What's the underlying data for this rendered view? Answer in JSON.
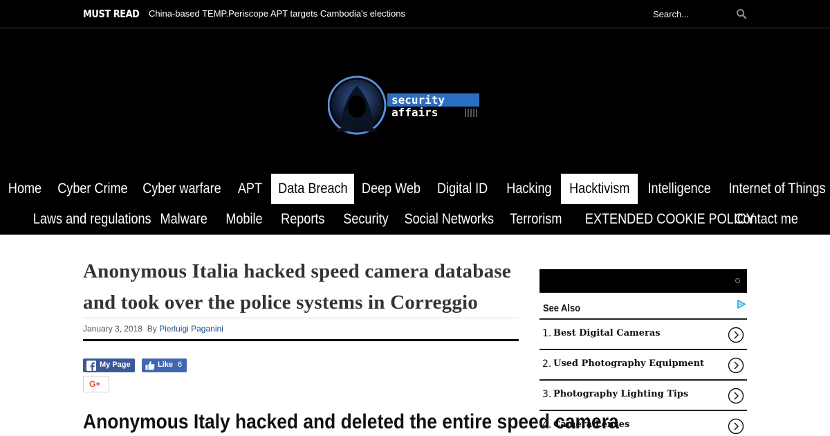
{
  "topbar": {
    "must_read_label": "MUST READ",
    "headline": "China-based TEMP.Periscope APT targets Cambodia's elections",
    "search_placeholder": "Search...",
    "search_icon": "search-icon"
  },
  "logo": {
    "line1": "security",
    "line2": "affairs"
  },
  "nav": {
    "items": [
      {
        "label": "Home",
        "active": false
      },
      {
        "label": "Cyber Crime",
        "active": false
      },
      {
        "label": "Cyber warfare",
        "active": false
      },
      {
        "label": "APT",
        "active": false
      },
      {
        "label": "Data Breach",
        "active": true
      },
      {
        "label": "Deep Web",
        "active": false
      },
      {
        "label": "Digital ID",
        "active": false
      },
      {
        "label": "Hacking",
        "active": false
      },
      {
        "label": "Hacktivism",
        "active": true
      },
      {
        "label": "Intelligence",
        "active": false
      },
      {
        "label": "Internet of Things",
        "active": false
      },
      {
        "label": "Laws and regulations",
        "active": false
      },
      {
        "label": "Malware",
        "active": false
      },
      {
        "label": "Mobile",
        "active": false
      },
      {
        "label": "Reports",
        "active": false
      },
      {
        "label": "Security",
        "active": false
      },
      {
        "label": "Social Networks",
        "active": false
      },
      {
        "label": "Terrorism",
        "active": false
      },
      {
        "label": "EXTENDED COOKIE POLICY",
        "active": false
      },
      {
        "label": "Contact me",
        "active": false
      }
    ]
  },
  "article": {
    "title": "Anonymous Italia hacked speed camera database and took over the police systems in Correggio",
    "date": "January 3, 2018",
    "by_label": "By",
    "author": "Pierluigi Paganini",
    "share": {
      "facebook_label": "My Page",
      "like_label": "Like",
      "like_count": "6",
      "gplus_label": "G+"
    },
    "subheading": "Anonymous Italy hacked and deleted the entire speed camera"
  },
  "sidebar": {
    "see_also_label": "See Also",
    "items": [
      {
        "num": "1.",
        "label": "Best Digital Cameras"
      },
      {
        "num": "2.",
        "label": "Used Photography Equipment"
      },
      {
        "num": "3.",
        "label": "Photography Lighting Tips"
      },
      {
        "num": "4.",
        "label": "Camera Lenses"
      }
    ]
  },
  "colors": {
    "header_bg": "#000000",
    "active_nav_bg": "#ffffff",
    "author_link": "#1a4f8a",
    "facebook_blue": "#3b5998",
    "like_blue": "#4267b2",
    "gplus_red": "#dd4b39",
    "logo_blue": "#2b6fc4"
  }
}
